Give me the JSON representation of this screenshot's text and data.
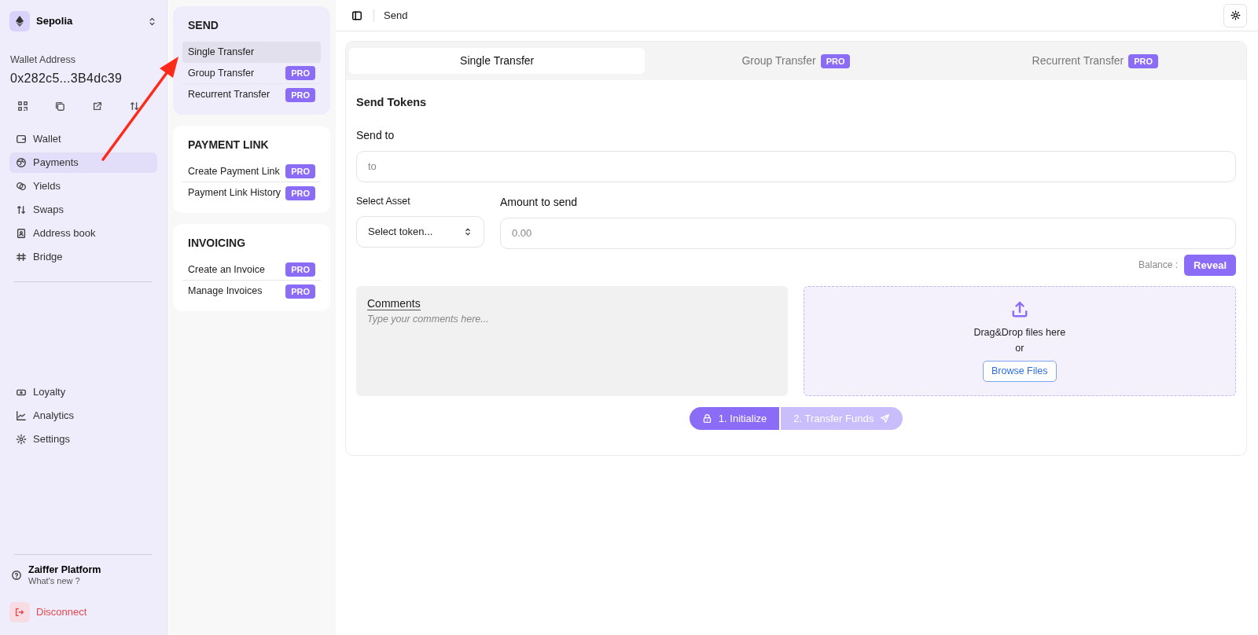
{
  "network": {
    "name": "Sepolia"
  },
  "wallet": {
    "label": "Wallet Address",
    "address": "0x282c5...3B4dc39"
  },
  "nav_top": [
    {
      "label": "Wallet",
      "selected": false
    },
    {
      "label": "Payments",
      "selected": true
    },
    {
      "label": "Yields",
      "selected": false
    },
    {
      "label": "Swaps",
      "selected": false
    },
    {
      "label": "Address book",
      "selected": false
    },
    {
      "label": "Bridge",
      "selected": false
    }
  ],
  "nav_bottom": [
    {
      "label": "Loyalty",
      "selected": false
    },
    {
      "label": "Analytics",
      "selected": false
    },
    {
      "label": "Settings",
      "selected": false
    }
  ],
  "footer": {
    "title": "Zaiffer Platform",
    "subtitle": "What's new ?",
    "disconnect": "Disconnect"
  },
  "submenu": [
    {
      "title": "SEND",
      "selected": true,
      "items": [
        {
          "label": "Single Transfer",
          "selected": true
        },
        {
          "label": "Group Transfer",
          "selected": false,
          "badge": "PRO"
        },
        {
          "label": "Recurrent Transfer",
          "selected": false,
          "badge": "PRO"
        }
      ]
    },
    {
      "title": "PAYMENT LINK",
      "selected": false,
      "items": [
        {
          "label": "Create Payment Link",
          "selected": false,
          "badge": "PRO"
        },
        {
          "label": "Payment Link History",
          "selected": false,
          "badge": "PRO"
        }
      ]
    },
    {
      "title": "INVOICING",
      "selected": false,
      "items": [
        {
          "label": "Create an Invoice",
          "selected": false,
          "badge": "PRO"
        },
        {
          "label": "Manage Invoices",
          "selected": false,
          "badge": "PRO"
        }
      ]
    }
  ],
  "header": {
    "title": "Send"
  },
  "tabs": [
    {
      "label": "Single Transfer",
      "selected": true
    },
    {
      "label": "Group Transfer",
      "selected": false,
      "badge": "PRO"
    },
    {
      "label": "Recurrent Transfer",
      "selected": false,
      "badge": "PRO"
    }
  ],
  "form": {
    "title": "Send Tokens",
    "send_to_label": "Send to",
    "send_to_placeholder": "to",
    "asset_label": "Select Asset",
    "asset_value": "Select token...",
    "amount_label": "Amount to send",
    "amount_placeholder": "0.00",
    "balance_label": "Balance :",
    "reveal": "Reveal",
    "comments_label": "Comments",
    "comments_placeholder": "Type your comments here...",
    "drop_text": "Drag&Drop files here",
    "drop_or": "or",
    "browse": "Browse Files"
  },
  "steps": [
    {
      "label": "1. Initialize",
      "disabled": false
    },
    {
      "label": "2. Transfer Funds",
      "disabled": true
    }
  ]
}
